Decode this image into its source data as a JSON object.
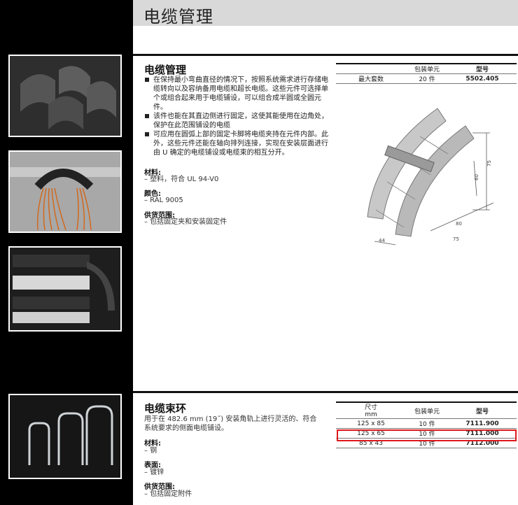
{
  "header": {
    "title": "电缆管理"
  },
  "section1": {
    "title": "电缆管理",
    "bullets": [
      "在保持最小弯曲直径的情况下，按照系统需求进行存储电缆转向以及容纳备用电缆和超长电缆。这些元件可选择单个或组合起来用于电缆铺设，可以组合成半圆或全圆元件。",
      "该件也能在其直边侧进行固定，这使其能使用在边角处，保护在此范围铺设的电缆",
      "可应用在圆弧上部的固定卡脚将电缆夹持在元件内部。此外，这些元件还能在轴向排列连接，实现在安装层面进行由 U 确定的电缆铺设或电缆束的相互分开。"
    ],
    "material_label": "材料:",
    "material_value": "– 塑料，符合 UL 94-V0",
    "color_label": "颜色:",
    "color_value": "– RAL 9005",
    "supply_label": "供货范围:",
    "supply_value": "– 包括固定夹和安装固定件",
    "table": {
      "headers": [
        "",
        "包装单元",
        "型号"
      ],
      "rows": [
        [
          "最大套数",
          "20 件",
          "5502.405"
        ]
      ]
    },
    "drawing_dims": [
      "75",
      "60",
      "80",
      "75",
      "44"
    ]
  },
  "section2": {
    "title": "电缆束环",
    "desc": "用于在 482.6 mm (19˝) 安装角轨上进行灵活的、符合系统要求的侧面电缆铺设。",
    "material_label": "材料:",
    "material_value": "– 钢",
    "surface_label": "表面:",
    "surface_value": "– 镀锌",
    "supply_label": "供货范围:",
    "supply_value": "– 包括固定附件",
    "table": {
      "headers": [
        "尺寸",
        "mm",
        "包装单元",
        "型号"
      ],
      "rows": [
        [
          "125 x 85",
          "10 件",
          "7111.900"
        ],
        [
          "125 x 65",
          "10 件",
          "7111.000"
        ],
        [
          "85 x 43",
          "10 件",
          "7112.000"
        ]
      ]
    }
  },
  "colors": {
    "highlight": "#e0191b",
    "header_band": "#d9d9d9",
    "sidebar": "#000000"
  }
}
